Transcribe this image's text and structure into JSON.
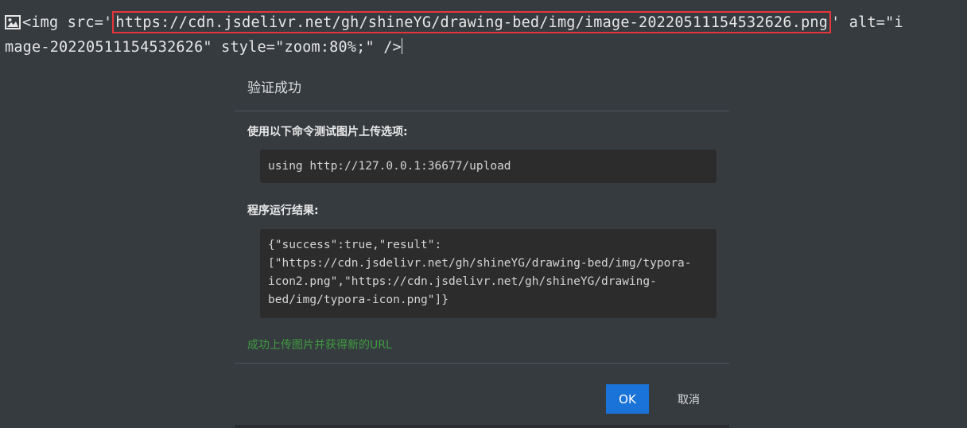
{
  "editor": {
    "line1_prefix": "<img src='",
    "url": "https://cdn.jsdelivr.net/gh/shineYG/drawing-bed/img/image-20220511154532626.png",
    "line1_suffix": "' alt=\"i",
    "line2": "mage-20220511154532626\" style=\"zoom:80%;\" />",
    "image_icon": "image-icon",
    "highlight_color": "#e5363b"
  },
  "dialog": {
    "title": "验证成功",
    "command_label": "使用以下命令测试图片上传选项:",
    "command": "using http://127.0.0.1:36677/upload",
    "result_label": "程序运行结果:",
    "result_lines": [
      "{\"success\":true,\"result\":",
      "[\"https://cdn.jsdelivr.net/gh/shineYG/drawing-bed/img/typora-",
      "icon2.png\",\"https://cdn.jsdelivr.net/gh/shineYG/drawing-",
      "bed/img/typora-icon.png\"]}"
    ],
    "success_message": "成功上传图片并获得新的URL",
    "ok_label": "OK",
    "cancel_label": "取消",
    "accent_color": "#1a73d9",
    "success_color": "#3f9c3f"
  }
}
